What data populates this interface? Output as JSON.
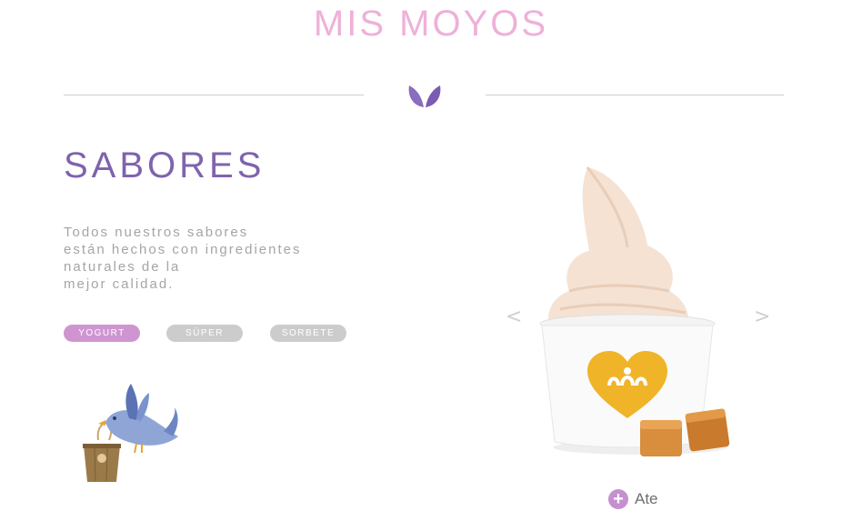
{
  "brand": {
    "title": "MIS MOYOS"
  },
  "section": {
    "title": "SABORES",
    "description_lines": [
      "Todos nuestros sabores",
      "están hechos con ingredientes",
      "naturales de la",
      "mejor calidad."
    ]
  },
  "categories": [
    {
      "label": "YOGURT",
      "active": true
    },
    {
      "label": "SÚPER",
      "active": false
    },
    {
      "label": "SORBETE",
      "active": false
    }
  ],
  "carousel": {
    "prev_label": "<",
    "next_label": ">",
    "current_flavor": "Ate",
    "add_symbol": "+"
  },
  "colors": {
    "brand_pink": "#eeb1d8",
    "purple": "#7f63ad",
    "active_pill": "#cf95d1",
    "inactive_pill": "#cccccc",
    "cup_logo": "#f0b429"
  },
  "icons": {
    "divider": "leaf-icon",
    "decoration": "bird-with-bucket-icon",
    "add": "plus-circle-icon"
  }
}
